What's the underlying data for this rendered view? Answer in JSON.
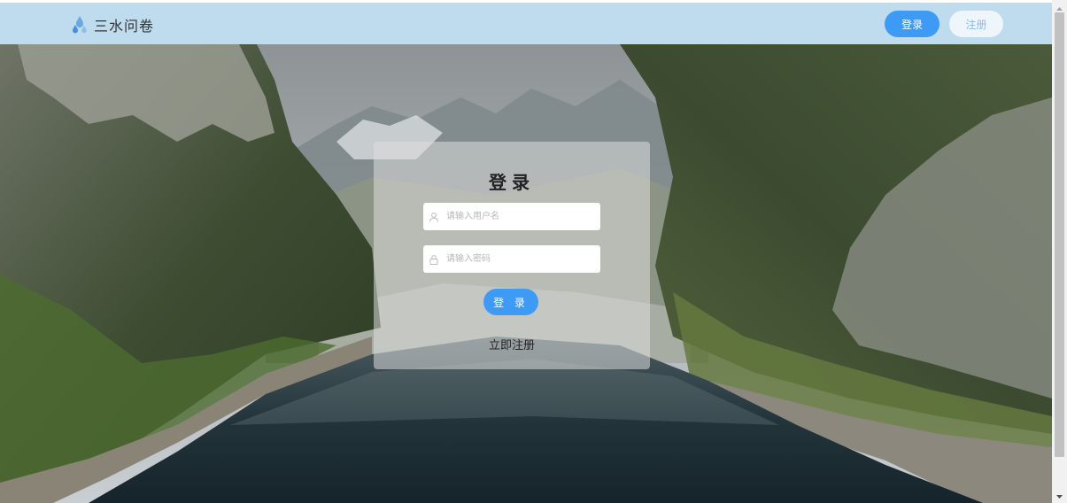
{
  "header": {
    "app_name": "三水问卷",
    "login_label": "登录",
    "register_label": "注册"
  },
  "login": {
    "title": "登录",
    "username_placeholder": "请输入用户名",
    "password_placeholder": "请输入密码",
    "submit_label": "登 录",
    "register_link": "立即注册"
  },
  "icons": {
    "logo": "water-drops-icon",
    "username": "user-icon",
    "password": "lock-icon"
  },
  "colors": {
    "header_bg": "#bfdcee",
    "primary": "#3d9bf6",
    "register_button_bg": "#eef5fb",
    "register_button_text": "#8fbbe3"
  }
}
